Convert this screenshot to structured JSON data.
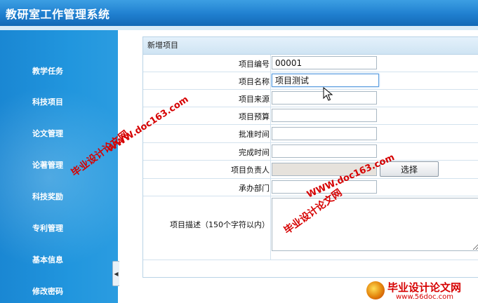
{
  "app": {
    "title": "教研室工作管理系统"
  },
  "sidebar": {
    "items": [
      {
        "label": "教学任务"
      },
      {
        "label": "科技项目"
      },
      {
        "label": "论文管理"
      },
      {
        "label": "论著管理"
      },
      {
        "label": "科技奖励"
      },
      {
        "label": "专利管理"
      },
      {
        "label": "基本信息"
      },
      {
        "label": "修改密码"
      }
    ]
  },
  "form": {
    "title": "新增项目",
    "fields": {
      "project_no": {
        "label": "项目编号",
        "value": "00001"
      },
      "project_name": {
        "label": "项目名称",
        "value": "项目测试"
      },
      "project_source": {
        "label": "项目来源",
        "value": ""
      },
      "project_budget": {
        "label": "项目预算",
        "value": ""
      },
      "approval_time": {
        "label": "批准时间",
        "value": ""
      },
      "completion_time": {
        "label": "完成时间",
        "value": ""
      },
      "leader": {
        "label": "项目负责人",
        "value": ""
      },
      "department": {
        "label": "承办部门",
        "value": ""
      },
      "description": {
        "label": "项目描述（150个字符以内）",
        "value": ""
      }
    },
    "select_button_label": "选择"
  },
  "watermarks": {
    "site_url": "WWW.doc163.com",
    "site_name": "毕业设计论文网",
    "logo_name": "毕业设计论文网",
    "logo_url": "www.56doc.com"
  },
  "colors": {
    "header": "#1f7fcf",
    "sidebar": "#2196de",
    "watermark": "#d60000"
  }
}
